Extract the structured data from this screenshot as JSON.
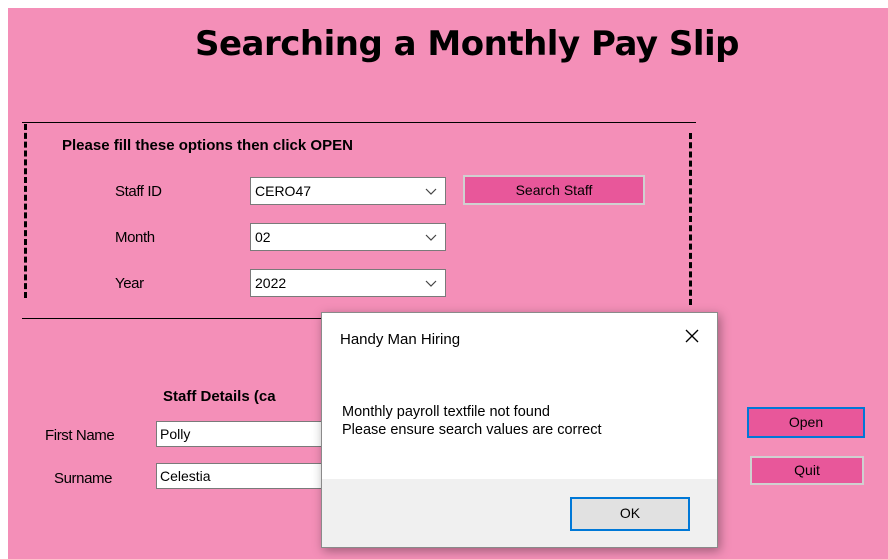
{
  "form": {
    "title": "Searching a Monthly Pay Slip",
    "group_title": "Please fill these options then click OPEN",
    "staff_id": {
      "label": "Staff ID",
      "value": "CERO47"
    },
    "month": {
      "label": "Month",
      "value": "02"
    },
    "year": {
      "label": "Year",
      "value": "2022"
    },
    "search_staff_label": "Search Staff",
    "staff_details_title": "Staff Details (ca",
    "first_name": {
      "label": "First Name",
      "value": "Polly"
    },
    "surname": {
      "label": "Surname",
      "value": "Celestia"
    },
    "open_label": "Open",
    "quit_label": "Quit"
  },
  "dialog": {
    "title": "Handy Man Hiring",
    "message_line1": "Monthly payroll textfile not found",
    "message_line2": "Please ensure search values are correct",
    "ok_label": "OK"
  },
  "colors": {
    "form_bg": "#f48fb8",
    "button_pink": "#e8579a",
    "focus_blue": "#0078d7"
  },
  "icons": [
    "chevron-down-icon",
    "close-icon"
  ]
}
